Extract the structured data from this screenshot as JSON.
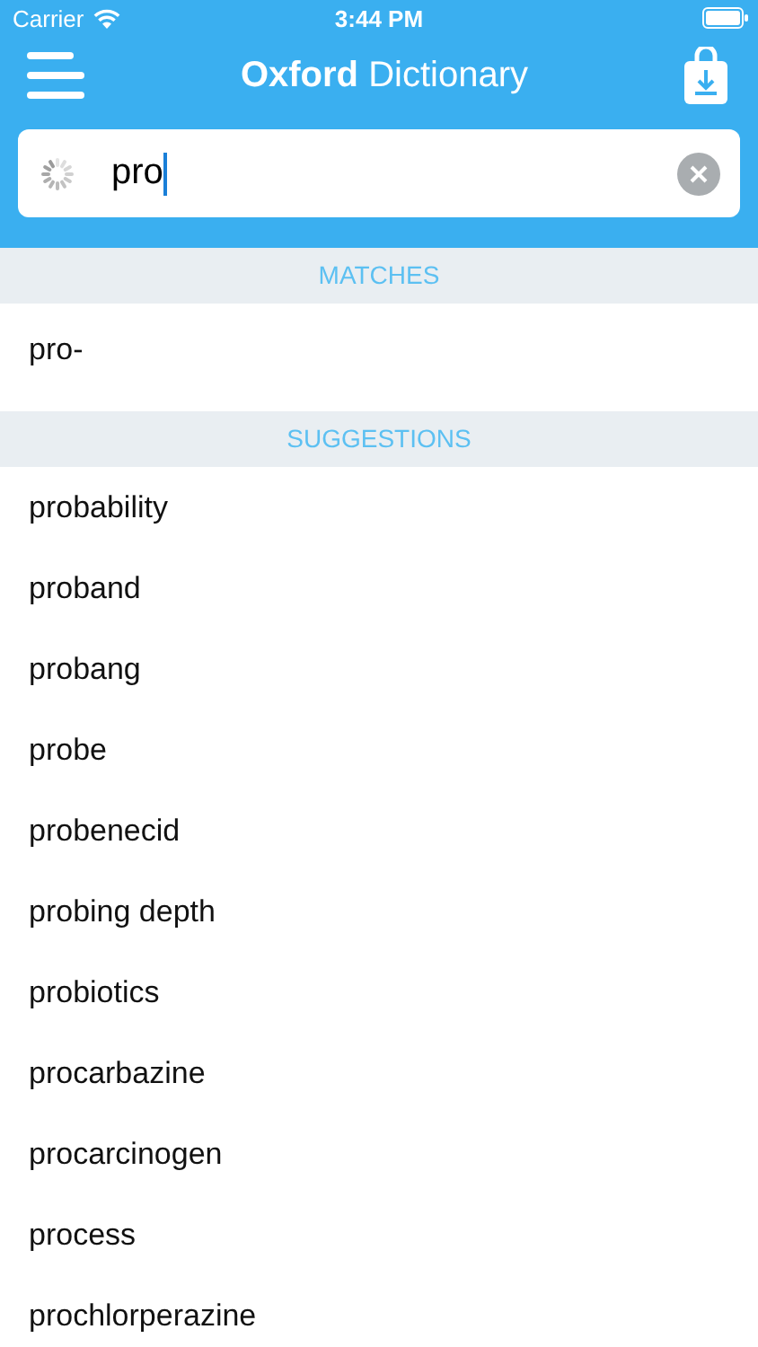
{
  "status_bar": {
    "carrier": "Carrier",
    "time": "3:44 PM"
  },
  "header": {
    "title": "**Oxford** Dictionary"
  },
  "search": {
    "value": "pro",
    "loading": true
  },
  "sections": [
    {
      "title": "MATCHES",
      "items": [
        "pro-"
      ]
    },
    {
      "title": "SUGGESTIONS",
      "items": [
        "probability",
        "proband",
        "probang",
        "probe",
        "probenecid",
        "probing depth",
        "probiotics",
        "procarbazine",
        "procarcinogen",
        "process",
        "prochlorperazine"
      ]
    }
  ]
}
